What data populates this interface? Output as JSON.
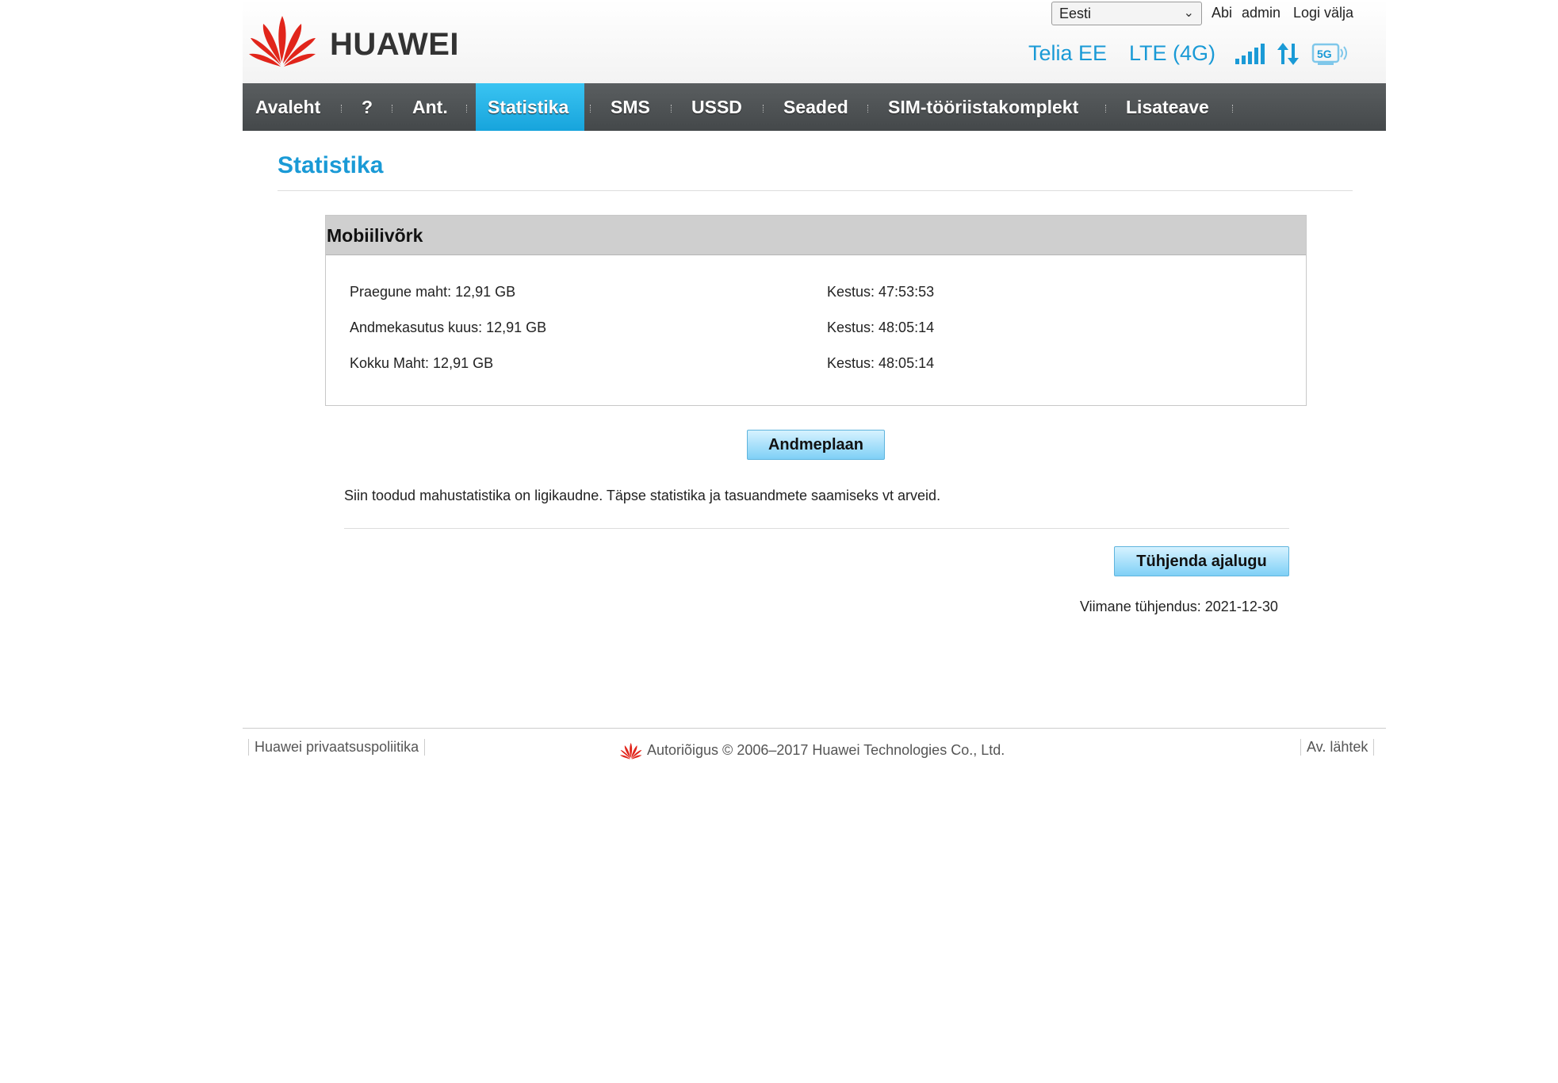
{
  "brand": {
    "name": "HUAWEI",
    "logo_color": "#e1251b"
  },
  "header": {
    "language": "Eesti",
    "links": {
      "help": "Abi",
      "user": "admin",
      "logout": "Logi välja"
    },
    "status": {
      "operator": "Telia EE",
      "network": "LTE (4G)"
    },
    "icons": [
      "signal-bars-icon",
      "data-transfer-icon",
      "5g-router-icon"
    ],
    "accent_color": "#1a9ad6"
  },
  "nav": {
    "items": [
      "Avaleht",
      "?",
      "Ant.",
      "Statistika",
      "SMS",
      "USSD",
      "Seaded",
      "SIM-tööriistakomplekt",
      "Lisateave"
    ],
    "active": "Statistika"
  },
  "page": {
    "title": "Statistika",
    "panel": {
      "title": "Mobiilivõrk",
      "rows": [
        {
          "label": "Praegune maht: 12,91 GB",
          "duration": "Kestus: 47:53:53"
        },
        {
          "label": "Andmekasutus kuus: 12,91 GB",
          "duration": "Kestus: 48:05:14"
        },
        {
          "label": "Kokku Maht: 12,91 GB",
          "duration": "Kestus: 48:05:14"
        }
      ]
    },
    "data_plan_button": "Andmeplaan",
    "note": "Siin toodud mahustatistika on ligikaudne. Täpse statistika ja tasuandmete saamiseks vt arveid.",
    "clear_button": "Tühjenda ajalugu",
    "last_cleared": "Viimane tühjendus: 2021-12-30"
  },
  "footer": {
    "privacy": "Huawei privaatsuspoliitika",
    "copyright": "Autoriõigus © 2006–2017 Huawei Technologies Co., Ltd.",
    "open_source": "Av. lähtek"
  }
}
